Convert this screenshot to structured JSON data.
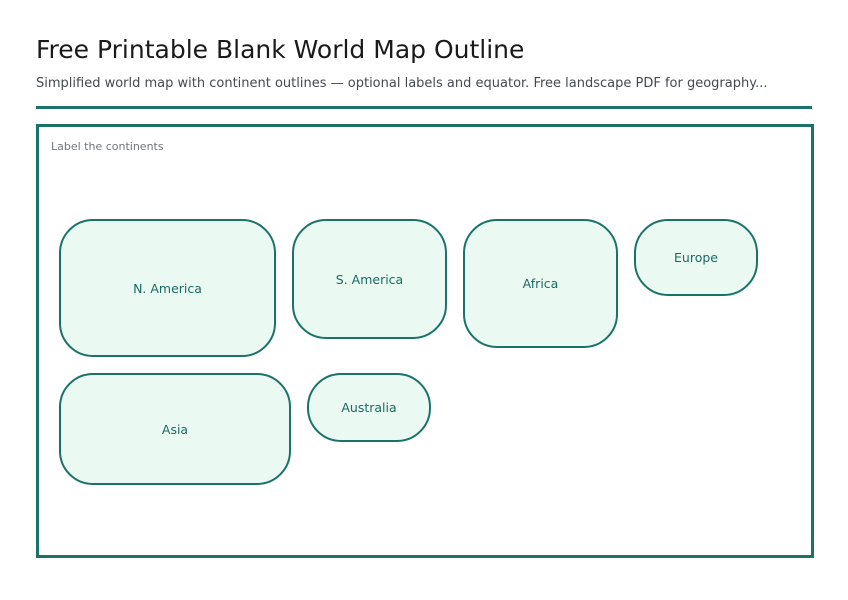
{
  "header": {
    "title": "Free Printable Blank World Map Outline",
    "subtitle": "Simplified world map with continent outlines — optional labels and equator. Free landscape PDF for geography..."
  },
  "map": {
    "caption": "Label the continents",
    "continents": [
      {
        "label": "N. America"
      },
      {
        "label": "S. America"
      },
      {
        "label": "Africa"
      },
      {
        "label": "Europe"
      },
      {
        "label": "Asia"
      },
      {
        "label": "Australia"
      }
    ]
  },
  "colors": {
    "accent": "#1a7268",
    "continent_fill": "#eafaf2",
    "label_text": "#1a6a62"
  }
}
